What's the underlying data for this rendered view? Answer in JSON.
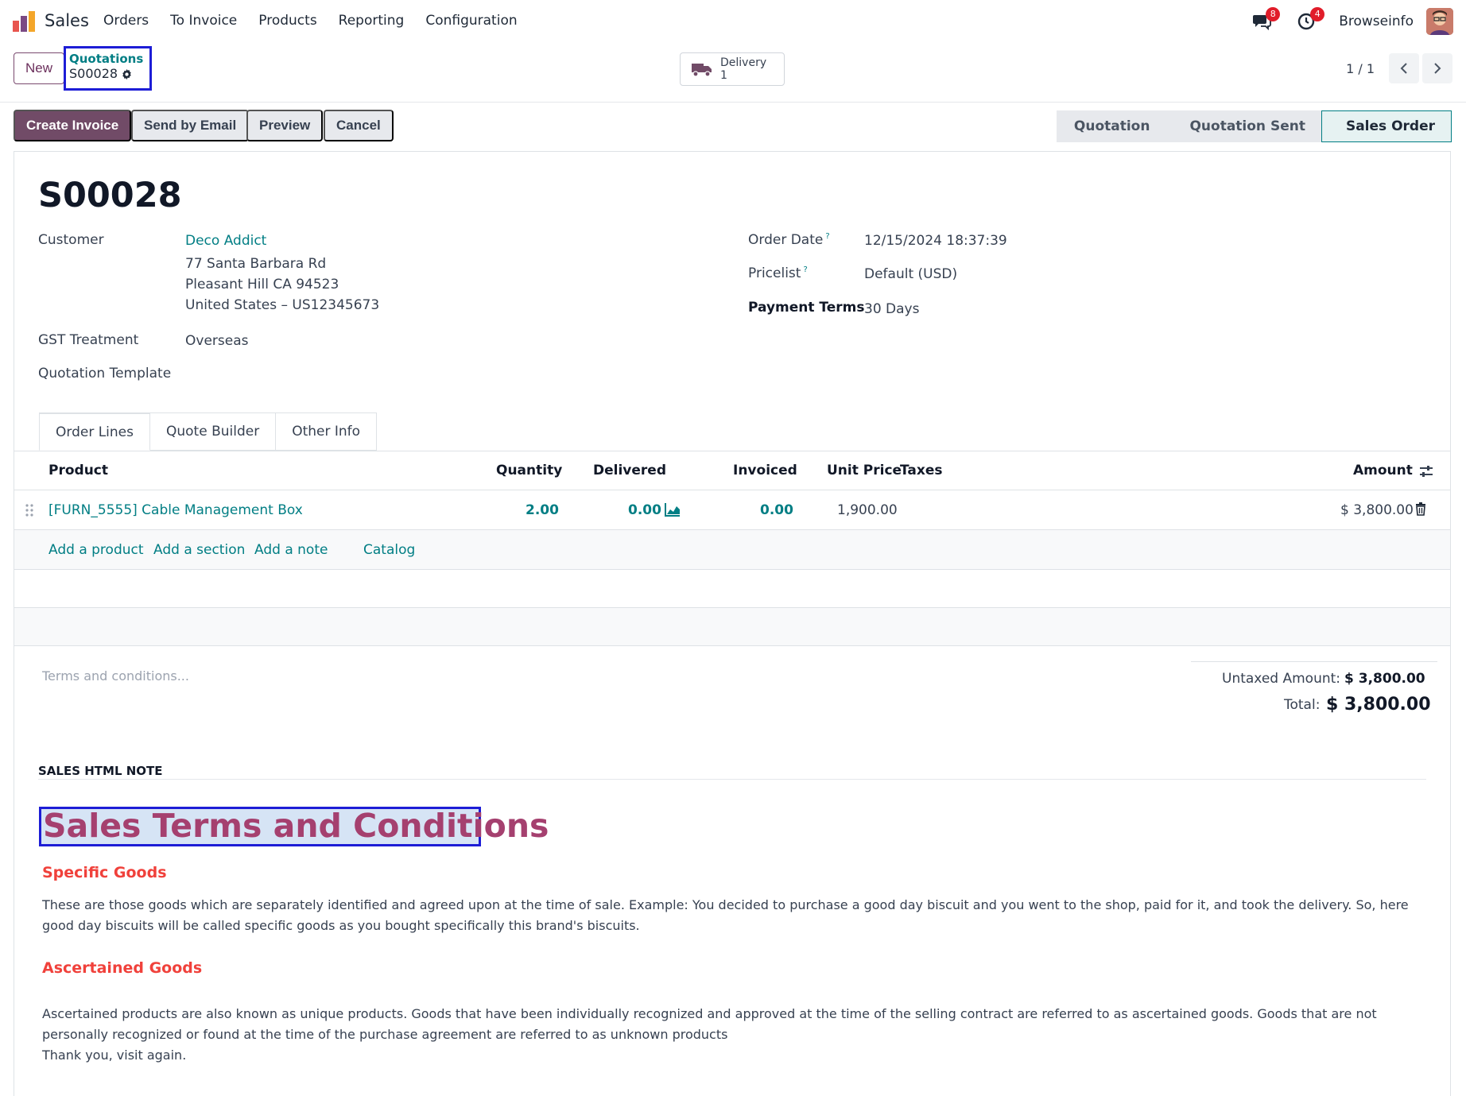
{
  "nav": {
    "app_name": "Sales",
    "menu": [
      "Orders",
      "To Invoice",
      "Products",
      "Reporting",
      "Configuration"
    ],
    "messages_count": "8",
    "activities_count": "4",
    "user_name": "Browseinfo"
  },
  "control": {
    "new_label": "New",
    "breadcrumb_parent": "Quotations",
    "breadcrumb_current": "S00028",
    "smart_button": {
      "label": "Delivery",
      "count": "1"
    },
    "pager": "1 / 1"
  },
  "actions": {
    "create_invoice": "Create Invoice",
    "send_email": "Send by Email",
    "preview": "Preview",
    "cancel": "Cancel"
  },
  "stages": [
    "Quotation",
    "Quotation Sent",
    "Sales Order"
  ],
  "active_stage": "Sales Order",
  "order": {
    "name": "S00028",
    "customer_label": "Customer",
    "customer_name": "Deco Addict",
    "address": [
      "77 Santa Barbara Rd",
      "Pleasant Hill CA 94523",
      "United States – US12345673"
    ],
    "gst_label": "GST Treatment",
    "gst_value": "Overseas",
    "template_label": "Quotation Template",
    "order_date_label": "Order Date",
    "order_date": "12/15/2024 18:37:39",
    "pricelist_label": "Pricelist",
    "pricelist": "Default (USD)",
    "payment_terms_label": "Payment Terms",
    "payment_terms": "30 Days",
    "tip_mark": "?"
  },
  "tabs": [
    "Order Lines",
    "Quote Builder",
    "Other Info"
  ],
  "table": {
    "headers": {
      "product": "Product",
      "quantity": "Quantity",
      "delivered": "Delivered",
      "invoiced": "Invoiced",
      "unit_price": "Unit Price",
      "taxes": "Taxes",
      "amount": "Amount"
    },
    "rows": [
      {
        "product": "[FURN_5555] Cable Management Box",
        "quantity": "2.00",
        "delivered": "0.00",
        "invoiced": "0.00",
        "unit_price": "1,900.00",
        "taxes": "",
        "amount": "$ 3,800.00"
      }
    ],
    "add_links": [
      "Add a product",
      "Add a section",
      "Add a note",
      "Catalog"
    ]
  },
  "terms_placeholder": "Terms and conditions...",
  "totals": {
    "untaxed_label": "Untaxed Amount:",
    "untaxed_value": "$ 3,800.00",
    "total_label": "Total:",
    "total_value": "$ 3,800.00"
  },
  "note": {
    "section_title": "SALES HTML NOTE",
    "heading": "Sales Terms and Conditions",
    "sub1": "Specific Goods",
    "para1": "These are those goods which are separately identified and agreed upon at the time of sale. Example: You decided to purchase a good day biscuit and you went to the shop, paid for it, and took the delivery. So, here good day biscuits will be called specific goods as you bought specifically this brand's biscuits.",
    "sub2": "Ascertained Goods",
    "para2": "Ascertained products are also known as unique products. Goods that have been individually recognized and approved at the time of the selling contract are referred to as ascertained goods. Goods that are not personally recognized or found at the time of the purchase agreement are referred to as unknown products",
    "para3": "Thank you, visit again."
  },
  "colors": {
    "brand": "#714b67",
    "link": "#017e84",
    "heading_note": "#a5406f",
    "subheading_note": "#f0413b",
    "badge": "#e11d2a"
  }
}
